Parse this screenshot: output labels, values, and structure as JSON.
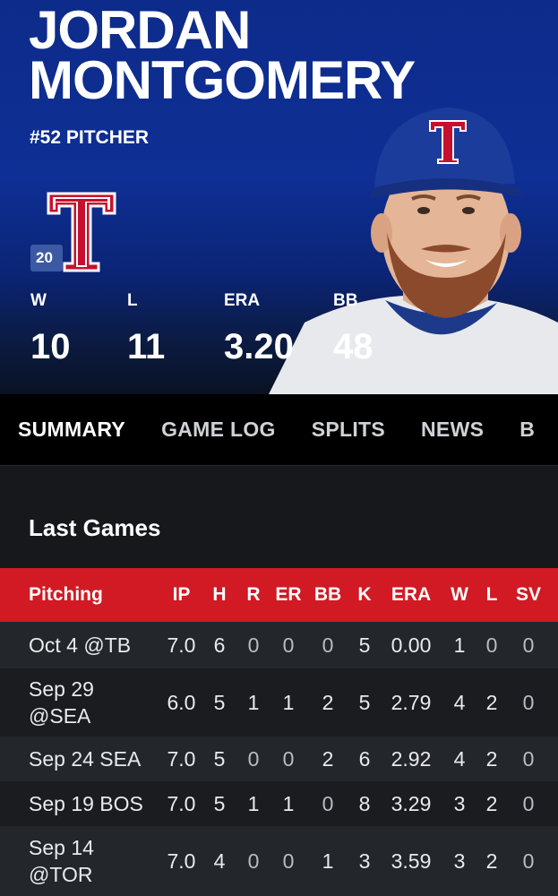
{
  "player": {
    "first_name": "JORDAN",
    "last_name": "MONTGOMERY",
    "info": "#52 PITCHER",
    "season_badge": "20",
    "team_logo": "texas-rangers-logo"
  },
  "stats": [
    {
      "label": "W",
      "value": "10"
    },
    {
      "label": "L",
      "value": "11"
    },
    {
      "label": "ERA",
      "value": "3.20"
    },
    {
      "label": "BB",
      "value": "48"
    }
  ],
  "tabs": [
    "SUMMARY",
    "GAME LOG",
    "SPLITS",
    "NEWS",
    "B"
  ],
  "last_games": {
    "title": "Last Games",
    "headers": [
      "Pitching",
      "IP",
      "H",
      "R",
      "ER",
      "BB",
      "K",
      "ERA",
      "W",
      "L",
      "SV"
    ],
    "rows": [
      {
        "game": "Oct 4 @TB",
        "ip": "7.0",
        "h": "6",
        "r": "0",
        "er": "0",
        "bb": "0",
        "k": "5",
        "era": "0.00",
        "w": "1",
        "l": "0",
        "sv": "0"
      },
      {
        "game": "Sep 29 @SEA",
        "ip": "6.0",
        "h": "5",
        "r": "1",
        "er": "1",
        "bb": "2",
        "k": "5",
        "era": "2.79",
        "w": "4",
        "l": "2",
        "sv": "0"
      },
      {
        "game": "Sep 24 SEA",
        "ip": "7.0",
        "h": "5",
        "r": "0",
        "er": "0",
        "bb": "2",
        "k": "6",
        "era": "2.92",
        "w": "4",
        "l": "2",
        "sv": "0"
      },
      {
        "game": "Sep 19 BOS",
        "ip": "7.0",
        "h": "5",
        "r": "1",
        "er": "1",
        "bb": "0",
        "k": "8",
        "era": "3.29",
        "w": "3",
        "l": "2",
        "sv": "0"
      },
      {
        "game": "Sep 14 @TOR",
        "ip": "7.0",
        "h": "4",
        "r": "0",
        "er": "0",
        "bb": "1",
        "k": "3",
        "era": "3.59",
        "w": "3",
        "l": "2",
        "sv": "0"
      }
    ]
  },
  "colors": {
    "hero_blue": "#0e2f95",
    "header_red": "#d11a24",
    "rangers_red": "#c8102e"
  }
}
